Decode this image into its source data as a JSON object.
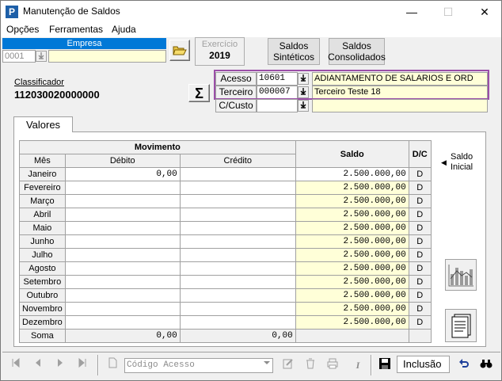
{
  "window": {
    "app_icon": "P",
    "title": "Manutenção de Saldos",
    "minimize": "—",
    "maximize": "☐",
    "close": "✕"
  },
  "menu": {
    "items": [
      {
        "label": "Opções"
      },
      {
        "label": "Ferramentas"
      },
      {
        "label": "Ajuda"
      }
    ]
  },
  "empresa": {
    "header": "Empresa",
    "code": "0001",
    "name": ""
  },
  "exercicio": {
    "label": "Exercício",
    "value": "2019"
  },
  "buttons": {
    "saldos_sinteticos_line1": "Saldos",
    "saldos_sinteticos_line2": "Sintéticos",
    "saldos_consolidados_line1": "Saldos",
    "saldos_consolidados_line2": "Consolidados",
    "sigma": "Σ"
  },
  "classificador": {
    "label": "Classificador",
    "value": "112030020000000"
  },
  "account": {
    "acesso_label": "Acesso",
    "acesso_code": "10601",
    "acesso_desc": "ADIANTAMENTO DE SALARIOS E ORD",
    "terceiro_label": "Terceiro",
    "terceiro_code": "000007",
    "terceiro_desc": "Terceiro Teste 18",
    "ccusto_label": "C/Custo",
    "ccusto_code": "",
    "ccusto_desc": ""
  },
  "tabs": {
    "valores": "Valores"
  },
  "grid": {
    "header_movimento": "Movimento",
    "header_saldo": "Saldo",
    "header_dc": "D/C",
    "col_mes": "Mês",
    "col_debito": "Débito",
    "col_credito": "Crédito",
    "rows": [
      {
        "mes": "Janeiro",
        "debito": "0,00",
        "credito": "",
        "saldo": "2.500.000,00",
        "dc": "D"
      },
      {
        "mes": "Fevereiro",
        "debito": "",
        "credito": "",
        "saldo": "2.500.000,00",
        "dc": "D"
      },
      {
        "mes": "Março",
        "debito": "",
        "credito": "",
        "saldo": "2.500.000,00",
        "dc": "D"
      },
      {
        "mes": "Abril",
        "debito": "",
        "credito": "",
        "saldo": "2.500.000,00",
        "dc": "D"
      },
      {
        "mes": "Maio",
        "debito": "",
        "credito": "",
        "saldo": "2.500.000,00",
        "dc": "D"
      },
      {
        "mes": "Junho",
        "debito": "",
        "credito": "",
        "saldo": "2.500.000,00",
        "dc": "D"
      },
      {
        "mes": "Julho",
        "debito": "",
        "credito": "",
        "saldo": "2.500.000,00",
        "dc": "D"
      },
      {
        "mes": "Agosto",
        "debito": "",
        "credito": "",
        "saldo": "2.500.000,00",
        "dc": "D"
      },
      {
        "mes": "Setembro",
        "debito": "",
        "credito": "",
        "saldo": "2.500.000,00",
        "dc": "D"
      },
      {
        "mes": "Outubro",
        "debito": "",
        "credito": "",
        "saldo": "2.500.000,00",
        "dc": "D"
      },
      {
        "mes": "Novembro",
        "debito": "",
        "credito": "",
        "saldo": "2.500.000,00",
        "dc": "D"
      },
      {
        "mes": "Dezembro",
        "debito": "",
        "credito": "",
        "saldo": "2.500.000,00",
        "dc": "D"
      }
    ],
    "soma_label": "Soma",
    "soma_debito": "0,00",
    "soma_credito": "0,00"
  },
  "saldo_inicial": {
    "arrow": "◀",
    "line1": "Saldo",
    "line2": "Inicial"
  },
  "toolbar": {
    "search_placeholder": "Código Acesso",
    "mode": "Inclusão"
  }
}
